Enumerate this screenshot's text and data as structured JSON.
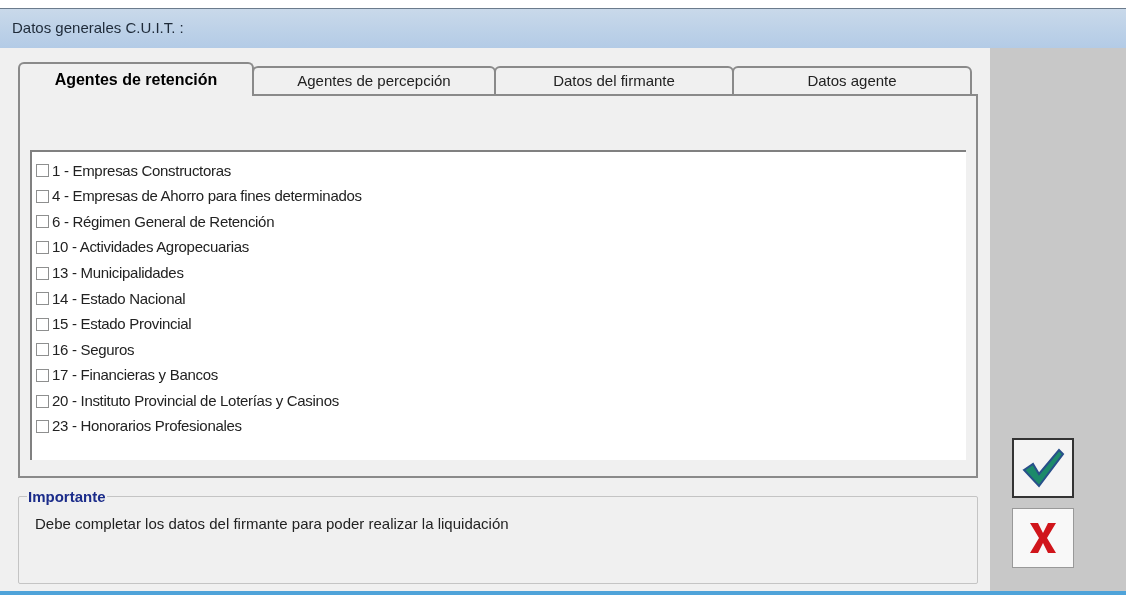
{
  "window": {
    "title": "Datos generales C.U.I.T. :"
  },
  "tabs": [
    {
      "label": "Agentes de retención",
      "selected": true
    },
    {
      "label": "Agentes de percepción",
      "selected": false
    },
    {
      "label": "Datos del firmante",
      "selected": false
    },
    {
      "label": "Datos agente",
      "selected": false
    }
  ],
  "items": [
    {
      "label": "1 - Empresas Constructoras",
      "checked": false
    },
    {
      "label": "4 - Empresas de Ahorro para fines determinados",
      "checked": false
    },
    {
      "label": "6 - Régimen General de Retención",
      "checked": false
    },
    {
      "label": "10 - Actividades Agropecuarias",
      "checked": false
    },
    {
      "label": "13 - Municipalidades",
      "checked": false
    },
    {
      "label": "14 - Estado Nacional",
      "checked": false
    },
    {
      "label": "15 - Estado Provincial",
      "checked": false
    },
    {
      "label": "16 - Seguros",
      "checked": false
    },
    {
      "label": "17 - Financieras y Bancos",
      "checked": false
    },
    {
      "label": "20 - Instituto Provincial de Loterías y Casinos",
      "checked": false
    },
    {
      "label": "23 - Honorarios Profesionales",
      "checked": false
    }
  ],
  "notice": {
    "title": "Importante",
    "text": "Debe completar los datos del firmante para poder realizar la liquidación"
  }
}
